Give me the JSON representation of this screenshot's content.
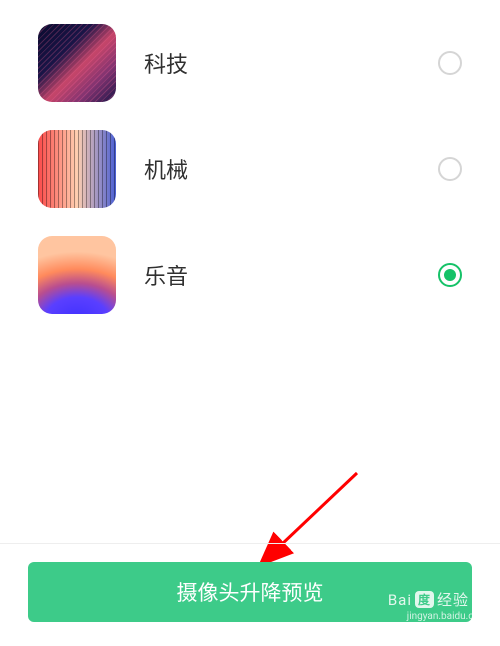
{
  "options": [
    {
      "id": "tech",
      "label": "科技",
      "selected": false
    },
    {
      "id": "mechanical",
      "label": "机械",
      "selected": false
    },
    {
      "id": "music",
      "label": "乐音",
      "selected": true
    }
  ],
  "footer": {
    "preview_button": "摄像头升降预览"
  },
  "watermark": {
    "brand_prefix": "Bai",
    "brand_du": "度",
    "brand_suffix": "经验",
    "url": "jingyan.baidu.com"
  },
  "colors": {
    "accent": "#15c268",
    "button_bg": "#3dcb89",
    "arrow": "#ff0000"
  }
}
